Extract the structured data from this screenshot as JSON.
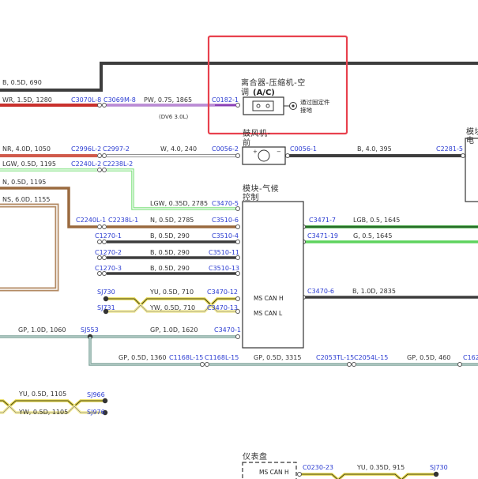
{
  "diagram": {
    "components": {
      "ac_clutch_label_line1": "离合器-压缩机-空",
      "ac_clutch_label_line2": "调",
      "ac_clutch_abbrev": "(A/C)",
      "ground_note_line1": "通过固定件",
      "ground_note_line2": "接地",
      "blower_label_line1": "鼓风机-",
      "blower_label_line2": "前",
      "climate_module_line1": "模块-气候",
      "climate_module_line2": "控制",
      "ms_can_h": "MS CAN H",
      "ms_can_l": "MS CAN L",
      "right_module_line1": "模块",
      "right_module_line2": "电",
      "cluster_label": "仪表盘",
      "cluster_ms_can_h": "MS CAN H",
      "engine_note": "(DV6 3.0L)"
    },
    "wires": {
      "w_b_05_690": "B, 0.5D, 690",
      "w_wr_15_1280": "WR, 1.5D, 1280",
      "w_pw_075_1865": "PW, 0.75, 1865",
      "w_nr_40_1050": "NR, 4.0D, 1050",
      "w_w_40_240": "W, 4.0, 240",
      "w_b_40_395": "B, 4.0, 395",
      "w_lgw_05_1195": "LGW, 0.5D, 1195",
      "w_n_05_1195": "N, 0.5D, 1195",
      "w_ns_60_1155": "NS, 6.0D, 1155",
      "w_lgw_035_2785": "LGW, 0.35D, 2785",
      "w_n_05_2785": "N, 0.5D, 2785",
      "w_b_05_290_a": "B, 0.5D, 290",
      "w_b_05_290_b": "B, 0.5D, 290",
      "w_b_05_290_c": "B, 0.5D, 290",
      "w_lgb_05_1645": "LGB, 0.5, 1645",
      "w_g_05_1645": "G, 0.5, 1645",
      "w_yu_05_710": "YU, 0.5D, 710",
      "w_yw_05_710": "YW, 0.5D, 710",
      "w_b_10_2835": "B, 1.0D, 2835",
      "w_gp_10_1060": "GP, 1.0D, 1060",
      "w_gp_10_1620": "GP, 1.0D, 1620",
      "w_gp_05_1360": "GP, 0.5D, 1360",
      "w_gp_05_3315": "GP, 0.5D, 3315",
      "w_gp_05_460": "GP, 0.5D, 460",
      "w_yu_05_1105": "YU, 0.5D, 1105",
      "w_yw_05_1105": "YW, 0.5D, 1105",
      "w_yu_035_915": "YU, 0.35D, 915"
    },
    "connectors": {
      "c3070l_8": "C3070L-8",
      "c3069m_8": "C3069M-8",
      "c0182_1": "C0182-1",
      "c2996l_2": "C2996L-2",
      "c2997_2": "C2997-2",
      "c0056_2": "C0056-2",
      "c0056_1": "C0056-1",
      "c2281_5": "C2281-5",
      "c2240l_2": "C2240L-2",
      "c2238l_2": "C2238L-2",
      "c3470_5": "C3470-5",
      "c2240l_1": "C2240L-1",
      "c2238l_1": "C2238L-1",
      "c3510_6": "C3510-6",
      "c1270_1": "C1270-1",
      "c3510_4": "C3510-4",
      "c1270_2": "C1270-2",
      "c3510_11": "C3510-11",
      "c1270_3": "C1270-3",
      "c3510_13": "C3510-13",
      "c3471_7": "C3471-7",
      "c3471_19": "C3471-19",
      "sj730": "SJ730",
      "sj731": "SJ731",
      "c3470_12": "C3470-12",
      "c3470_13": "C3470-13",
      "c3470_6": "C3470-6",
      "sj553": "SJ553",
      "c3470_1": "C3470-1",
      "c1168l_15a": "C1168L-15",
      "c1168l_15b": "C1168L-15",
      "c2053tl_15": "C2053TL-15",
      "c2054l_15": "C2054L-15",
      "c162": "C162",
      "sj966": "SJ966",
      "sj976": "SJ976",
      "c0230_23": "C0230-23",
      "sj730_b": "SJ730"
    }
  },
  "colors": {
    "highlight_box": "#e8414e",
    "connector_text": "#2a3bd1"
  }
}
